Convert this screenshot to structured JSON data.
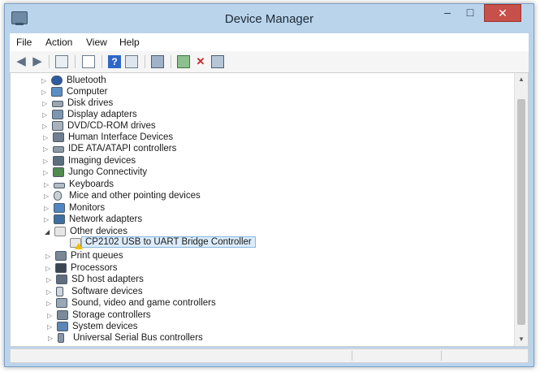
{
  "window": {
    "title": "Device Manager",
    "minimize": "‒",
    "maximize": "□",
    "close": "✕"
  },
  "menu": [
    "File",
    "Action",
    "View",
    "Help"
  ],
  "tree": [
    {
      "label": "Bluetooth",
      "icon": "bluetooth-icon",
      "expanded": false
    },
    {
      "label": "Computer",
      "icon": "computer-icon",
      "expanded": false
    },
    {
      "label": "Disk drives",
      "icon": "disk-drive-icon",
      "expanded": false
    },
    {
      "label": "Display adapters",
      "icon": "display-adapter-icon",
      "expanded": false
    },
    {
      "label": "DVD/CD-ROM drives",
      "icon": "dvd-drive-icon",
      "expanded": false
    },
    {
      "label": "Human Interface Devices",
      "icon": "hid-icon",
      "expanded": false
    },
    {
      "label": "IDE ATA/ATAPI controllers",
      "icon": "ide-controller-icon",
      "expanded": false
    },
    {
      "label": "Imaging devices",
      "icon": "imaging-device-icon",
      "expanded": false
    },
    {
      "label": "Jungo Connectivity",
      "icon": "jungo-icon",
      "expanded": false
    },
    {
      "label": "Keyboards",
      "icon": "keyboard-icon",
      "expanded": false
    },
    {
      "label": "Mice and other pointing devices",
      "icon": "mouse-icon",
      "expanded": false
    },
    {
      "label": "Monitors",
      "icon": "monitor-icon",
      "expanded": false
    },
    {
      "label": "Network adapters",
      "icon": "network-adapter-icon",
      "expanded": false
    },
    {
      "label": "Other devices",
      "icon": "other-devices-icon",
      "expanded": true
    },
    {
      "label": "CP2102 USB to UART Bridge Controller",
      "icon": "unknown-device-warning-icon",
      "child": true,
      "selected": true
    },
    {
      "label": "Print queues",
      "icon": "printer-icon",
      "expanded": false
    },
    {
      "label": "Processors",
      "icon": "processor-icon",
      "expanded": false
    },
    {
      "label": "SD host adapters",
      "icon": "sd-adapter-icon",
      "expanded": false
    },
    {
      "label": "Software devices",
      "icon": "software-device-icon",
      "expanded": false
    },
    {
      "label": "Sound, video and game controllers",
      "icon": "sound-icon",
      "expanded": false
    },
    {
      "label": "Storage controllers",
      "icon": "storage-controller-icon",
      "expanded": false
    },
    {
      "label": "System devices",
      "icon": "system-device-icon",
      "expanded": false
    },
    {
      "label": "Universal Serial Bus controllers",
      "icon": "usb-controller-icon",
      "expanded": false
    }
  ],
  "colors": {
    "window_frame": "#bad4ec",
    "close_button": "#c7504a",
    "selection_fill": "#dcecfb",
    "selection_border": "#88b6e0",
    "warning": "#f0c000"
  }
}
